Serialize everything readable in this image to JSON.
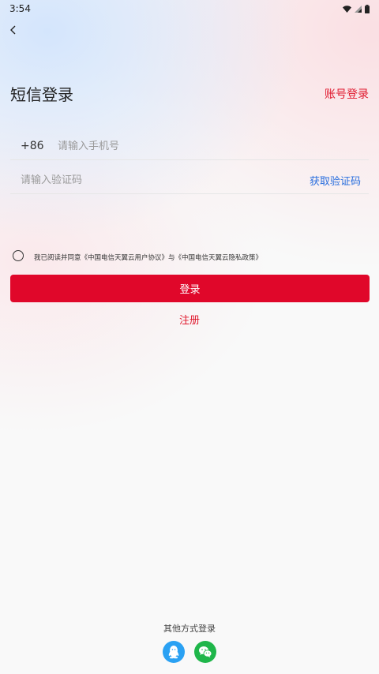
{
  "status_bar": {
    "time": "3:54",
    "icons": [
      "wifi-icon",
      "signal-icon",
      "battery-icon"
    ]
  },
  "header": {
    "back_icon": "back-arrow-icon",
    "title": "短信登录",
    "account_login": "账号登录"
  },
  "form": {
    "country_code": "+86",
    "phone_placeholder": "请输入手机号",
    "phone_value": "",
    "code_placeholder": "请输入验证码",
    "code_value": "",
    "get_code_label": "获取验证码"
  },
  "agreement": {
    "checked": false,
    "text": "我已阅读并同意《中国电信天翼云用户协议》与《中国电信天翼云隐私政策》"
  },
  "actions": {
    "login_label": "登录",
    "register_label": "注册"
  },
  "other_login": {
    "label": "其他方式登录",
    "options": [
      "qq-icon",
      "wechat-icon"
    ]
  },
  "colors": {
    "accent_red": "#e0072a",
    "link_blue": "#2a6fde",
    "qq_blue": "#2aa1f3",
    "wechat_green": "#1fb64a"
  }
}
